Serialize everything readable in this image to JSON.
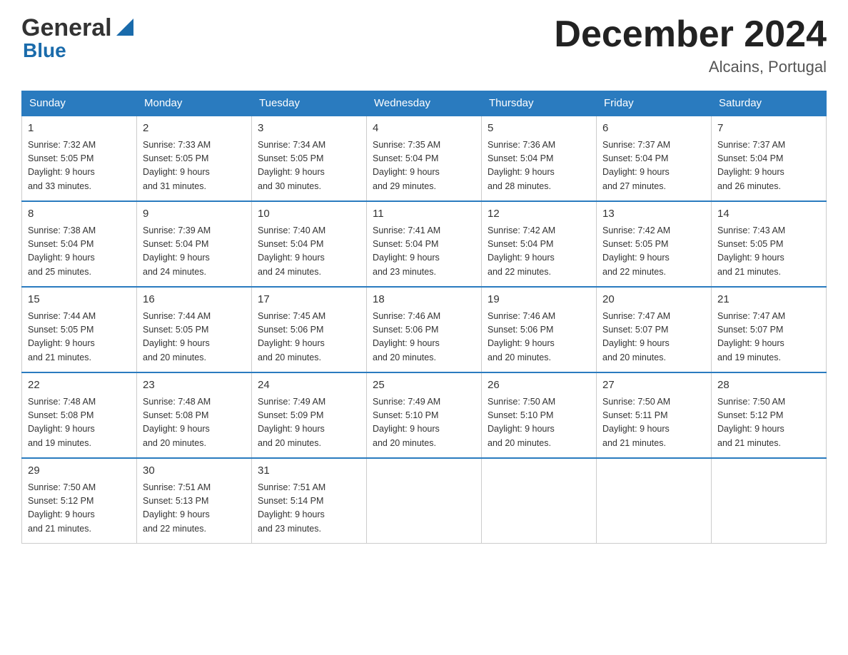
{
  "header": {
    "logo_general": "General",
    "logo_blue": "Blue",
    "month_title": "December 2024",
    "location": "Alcains, Portugal"
  },
  "days_of_week": [
    "Sunday",
    "Monday",
    "Tuesday",
    "Wednesday",
    "Thursday",
    "Friday",
    "Saturday"
  ],
  "weeks": [
    [
      {
        "day": "1",
        "sunrise": "7:32 AM",
        "sunset": "5:05 PM",
        "daylight": "9 hours and 33 minutes."
      },
      {
        "day": "2",
        "sunrise": "7:33 AM",
        "sunset": "5:05 PM",
        "daylight": "9 hours and 31 minutes."
      },
      {
        "day": "3",
        "sunrise": "7:34 AM",
        "sunset": "5:05 PM",
        "daylight": "9 hours and 30 minutes."
      },
      {
        "day": "4",
        "sunrise": "7:35 AM",
        "sunset": "5:04 PM",
        "daylight": "9 hours and 29 minutes."
      },
      {
        "day": "5",
        "sunrise": "7:36 AM",
        "sunset": "5:04 PM",
        "daylight": "9 hours and 28 minutes."
      },
      {
        "day": "6",
        "sunrise": "7:37 AM",
        "sunset": "5:04 PM",
        "daylight": "9 hours and 27 minutes."
      },
      {
        "day": "7",
        "sunrise": "7:37 AM",
        "sunset": "5:04 PM",
        "daylight": "9 hours and 26 minutes."
      }
    ],
    [
      {
        "day": "8",
        "sunrise": "7:38 AM",
        "sunset": "5:04 PM",
        "daylight": "9 hours and 25 minutes."
      },
      {
        "day": "9",
        "sunrise": "7:39 AM",
        "sunset": "5:04 PM",
        "daylight": "9 hours and 24 minutes."
      },
      {
        "day": "10",
        "sunrise": "7:40 AM",
        "sunset": "5:04 PM",
        "daylight": "9 hours and 24 minutes."
      },
      {
        "day": "11",
        "sunrise": "7:41 AM",
        "sunset": "5:04 PM",
        "daylight": "9 hours and 23 minutes."
      },
      {
        "day": "12",
        "sunrise": "7:42 AM",
        "sunset": "5:04 PM",
        "daylight": "9 hours and 22 minutes."
      },
      {
        "day": "13",
        "sunrise": "7:42 AM",
        "sunset": "5:05 PM",
        "daylight": "9 hours and 22 minutes."
      },
      {
        "day": "14",
        "sunrise": "7:43 AM",
        "sunset": "5:05 PM",
        "daylight": "9 hours and 21 minutes."
      }
    ],
    [
      {
        "day": "15",
        "sunrise": "7:44 AM",
        "sunset": "5:05 PM",
        "daylight": "9 hours and 21 minutes."
      },
      {
        "day": "16",
        "sunrise": "7:44 AM",
        "sunset": "5:05 PM",
        "daylight": "9 hours and 20 minutes."
      },
      {
        "day": "17",
        "sunrise": "7:45 AM",
        "sunset": "5:06 PM",
        "daylight": "9 hours and 20 minutes."
      },
      {
        "day": "18",
        "sunrise": "7:46 AM",
        "sunset": "5:06 PM",
        "daylight": "9 hours and 20 minutes."
      },
      {
        "day": "19",
        "sunrise": "7:46 AM",
        "sunset": "5:06 PM",
        "daylight": "9 hours and 20 minutes."
      },
      {
        "day": "20",
        "sunrise": "7:47 AM",
        "sunset": "5:07 PM",
        "daylight": "9 hours and 20 minutes."
      },
      {
        "day": "21",
        "sunrise": "7:47 AM",
        "sunset": "5:07 PM",
        "daylight": "9 hours and 19 minutes."
      }
    ],
    [
      {
        "day": "22",
        "sunrise": "7:48 AM",
        "sunset": "5:08 PM",
        "daylight": "9 hours and 19 minutes."
      },
      {
        "day": "23",
        "sunrise": "7:48 AM",
        "sunset": "5:08 PM",
        "daylight": "9 hours and 20 minutes."
      },
      {
        "day": "24",
        "sunrise": "7:49 AM",
        "sunset": "5:09 PM",
        "daylight": "9 hours and 20 minutes."
      },
      {
        "day": "25",
        "sunrise": "7:49 AM",
        "sunset": "5:10 PM",
        "daylight": "9 hours and 20 minutes."
      },
      {
        "day": "26",
        "sunrise": "7:50 AM",
        "sunset": "5:10 PM",
        "daylight": "9 hours and 20 minutes."
      },
      {
        "day": "27",
        "sunrise": "7:50 AM",
        "sunset": "5:11 PM",
        "daylight": "9 hours and 21 minutes."
      },
      {
        "day": "28",
        "sunrise": "7:50 AM",
        "sunset": "5:12 PM",
        "daylight": "9 hours and 21 minutes."
      }
    ],
    [
      {
        "day": "29",
        "sunrise": "7:50 AM",
        "sunset": "5:12 PM",
        "daylight": "9 hours and 21 minutes."
      },
      {
        "day": "30",
        "sunrise": "7:51 AM",
        "sunset": "5:13 PM",
        "daylight": "9 hours and 22 minutes."
      },
      {
        "day": "31",
        "sunrise": "7:51 AM",
        "sunset": "5:14 PM",
        "daylight": "9 hours and 23 minutes."
      },
      null,
      null,
      null,
      null
    ]
  ],
  "labels": {
    "sunrise": "Sunrise:",
    "sunset": "Sunset:",
    "daylight": "Daylight:"
  }
}
